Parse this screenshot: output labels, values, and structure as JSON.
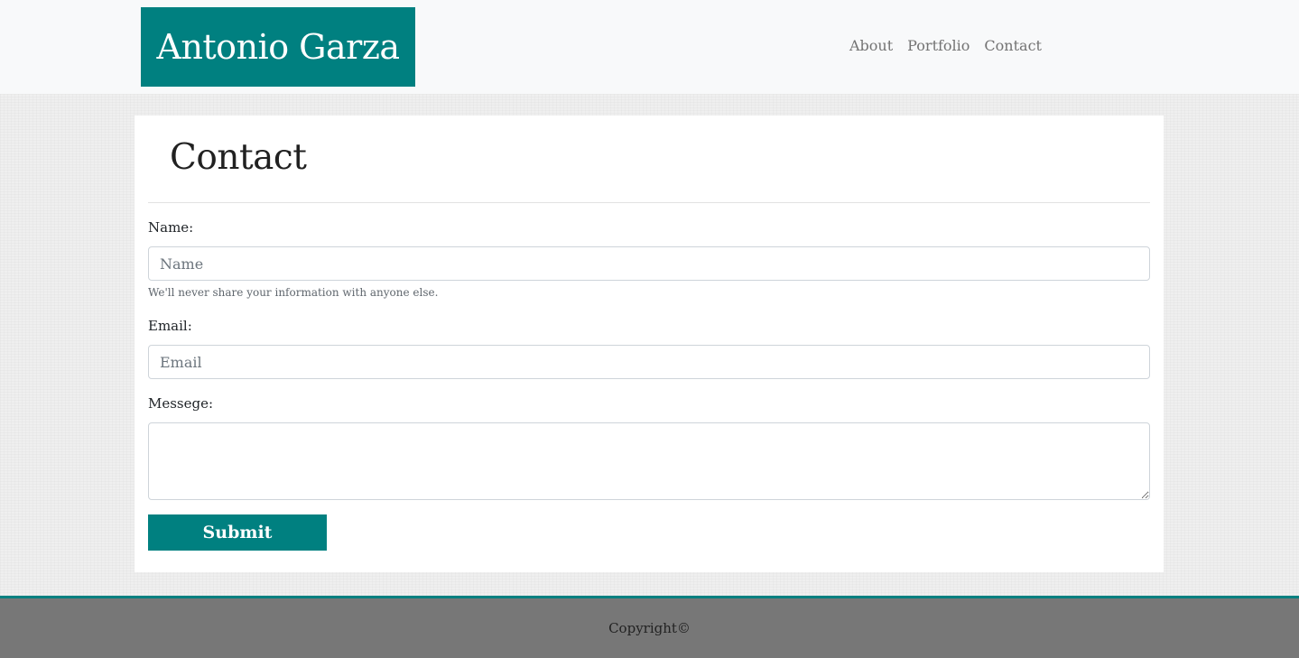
{
  "header": {
    "brand": "Antonio Garza",
    "nav": [
      {
        "label": "About"
      },
      {
        "label": "Portfolio"
      },
      {
        "label": "Contact"
      }
    ]
  },
  "contact": {
    "title": "Contact",
    "name_label": "Name:",
    "name_placeholder": "Name",
    "name_help": "We'll never share your information with anyone else.",
    "email_label": "Email:",
    "email_placeholder": "Email",
    "message_label": "Messege:",
    "message_value": "",
    "submit_label": "Submit"
  },
  "footer": {
    "copyright": "Copyright©"
  },
  "colors": {
    "brand": "#008080",
    "footer": "#777777",
    "navbar": "#f8f9fa"
  }
}
